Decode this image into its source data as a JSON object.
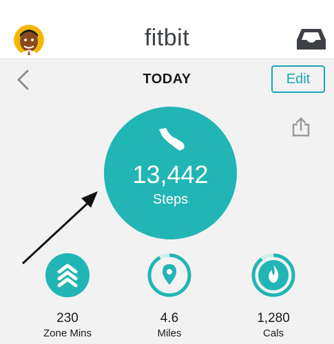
{
  "header": {
    "brand": "fitbit",
    "avatar_icon": "user-avatar-icon",
    "inbox_icon": "inbox-tray-icon"
  },
  "nav": {
    "title": "TODAY",
    "edit_label": "Edit",
    "back_icon": "chevron-left-icon",
    "share_icon": "share-icon"
  },
  "steps": {
    "value": "13,442",
    "label": "Steps",
    "icon": "shoe-icon"
  },
  "stats": [
    {
      "value": "230",
      "label": "Zone Mins",
      "icon": "zone-chevrons-icon",
      "progress": 1.0
    },
    {
      "value": "4.6",
      "label": "Miles",
      "icon": "location-pin-icon",
      "progress": 0.92
    },
    {
      "value": "1,280",
      "label": "Cals",
      "icon": "flame-icon",
      "progress": 0.9
    }
  ],
  "colors": {
    "accent": "#17a8b0",
    "circle": "#22b5b5",
    "background": "#f2f2f2"
  }
}
